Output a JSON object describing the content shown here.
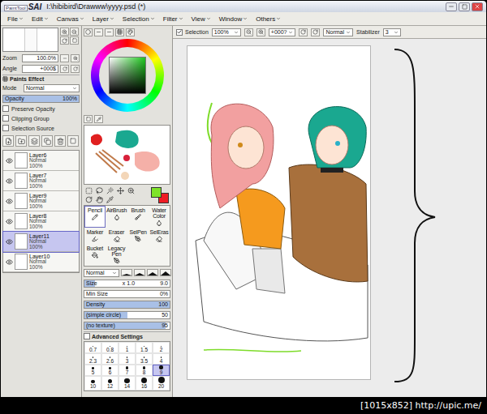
{
  "window": {
    "app_prefix": "PaintTool",
    "app_name": "SAI",
    "title": "I:\\hibibird\\Drawww\\yyyy.psd (*)"
  },
  "menu": [
    "File",
    "Edit",
    "Canvas",
    "Layer",
    "Selection",
    "Filter",
    "View",
    "Window",
    "Others"
  ],
  "toolbar": {
    "selection": {
      "label": "Selection",
      "checked": true
    },
    "zoom": "100%",
    "angle": "+000?",
    "mode": "Normal",
    "stabilizer": {
      "label": "Stabilizer",
      "value": "3"
    }
  },
  "navigator": {
    "zoom": {
      "label": "Zoom",
      "value": "100.0%"
    },
    "angle": {
      "label": "Angle",
      "value": "+000$"
    }
  },
  "paints_effect": {
    "title": "Paints Effect",
    "mode": {
      "label": "Mode",
      "value": "Normal"
    },
    "opacity": {
      "label": "Opacity",
      "value": "100%",
      "level": 1
    },
    "checkboxes": [
      {
        "label": "Preserve Opacity",
        "checked": false
      },
      {
        "label": "Clipping Group",
        "checked": false
      },
      {
        "label": "Selection Source",
        "checked": false
      }
    ]
  },
  "layers": [
    {
      "name": "Layer6",
      "mode": "Normal",
      "opacity": "100%",
      "visible": true,
      "selected": false
    },
    {
      "name": "Layer7",
      "mode": "Normal",
      "opacity": "100%",
      "visible": true,
      "selected": false
    },
    {
      "name": "Layer9",
      "mode": "Normal",
      "opacity": "100%",
      "visible": true,
      "selected": false
    },
    {
      "name": "Layer8",
      "mode": "Normal",
      "opacity": "100%",
      "visible": true,
      "selected": false
    },
    {
      "name": "Layer11",
      "mode": "Normal",
      "opacity": "100%",
      "visible": true,
      "selected": true
    },
    {
      "name": "Layer10",
      "mode": "Normal",
      "opacity": "100%",
      "visible": true,
      "selected": false
    }
  ],
  "color_swatches": [
    {
      "name": "foreground",
      "color": "#7ee32a"
    },
    {
      "name": "background",
      "color": "#ee1c24"
    }
  ],
  "tools": [
    {
      "label": "Pencil",
      "selected": true
    },
    {
      "label": "AirBrush",
      "selected": false
    },
    {
      "label": "Brush",
      "selected": false
    },
    {
      "label": "Water Color",
      "selected": false
    },
    {
      "label": "Marker",
      "selected": false
    },
    {
      "label": "Eraser",
      "selected": false
    },
    {
      "label": "SelPen",
      "selected": false
    },
    {
      "label": "SelEras",
      "selected": false
    },
    {
      "label": "Bucket",
      "selected": false
    },
    {
      "label": "Legacy Pen",
      "selected": false
    }
  ],
  "brush": {
    "mode": "Normal",
    "sliders": [
      {
        "label": "Size",
        "multiplier": "x 1.0",
        "value": "9.0",
        "level": 0.12
      },
      {
        "label": "Min Size",
        "multiplier": "",
        "value": "0%",
        "level": 0
      },
      {
        "label": "Density",
        "multiplier": "",
        "value": "100",
        "level": 1
      },
      {
        "label": "(simple circle)",
        "multiplier": "",
        "value": "50",
        "level": 0.5
      },
      {
        "label": "(no texture)",
        "multiplier": "",
        "value": "95",
        "level": 0.95
      }
    ],
    "advanced": "Advanced Settings",
    "sizes": [
      {
        "label": "0.7",
        "selected": false
      },
      {
        "label": "0.8",
        "selected": false
      },
      {
        "label": "1",
        "selected": false
      },
      {
        "label": "1.5",
        "selected": false
      },
      {
        "label": "2",
        "selected": false
      },
      {
        "label": "2.3",
        "selected": false
      },
      {
        "label": "2.6",
        "selected": false
      },
      {
        "label": "3",
        "selected": false
      },
      {
        "label": "3.5",
        "selected": false
      },
      {
        "label": "4",
        "selected": false
      },
      {
        "label": "5",
        "selected": false
      },
      {
        "label": "6",
        "selected": false
      },
      {
        "label": "7",
        "selected": false
      },
      {
        "label": "8",
        "selected": false
      },
      {
        "label": "9",
        "selected": true
      },
      {
        "label": "10",
        "selected": false
      },
      {
        "label": "12",
        "selected": false
      },
      {
        "label": "14",
        "selected": false
      },
      {
        "label": "16",
        "selected": false
      },
      {
        "label": "20",
        "selected": false
      }
    ]
  },
  "status": "[1015x852] http://upic.me/"
}
